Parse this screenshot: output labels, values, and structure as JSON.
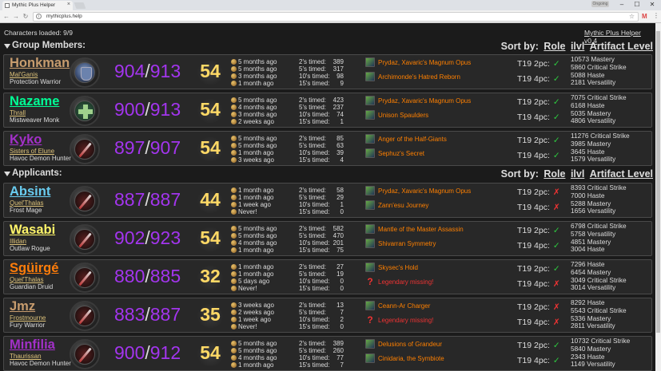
{
  "browser": {
    "tab_title": "Mythic Plus Helper",
    "tab_close": "×",
    "profile_label": "Ongoing",
    "url": "mythicplus.help",
    "win_min": "–",
    "win_max": "☐",
    "win_close": "✕"
  },
  "page": {
    "status": "Characters loaded: 9/9",
    "version": "Mythic Plus Helper v0.4"
  },
  "sections": {
    "group": {
      "title": "Group Members:"
    },
    "applicants": {
      "title": "Applicants:"
    },
    "sort_label": "Sort by:",
    "sort_options": [
      "Role",
      "ilvl",
      "Artifact Level"
    ]
  },
  "class_colors": {
    "warrior": "#c79c6e",
    "monk": "#00ff96",
    "demon_hunter": "#a330c9",
    "mage": "#69ccf0",
    "rogue": "#fff569",
    "druid": "#ff7d0a",
    "hunter": "#abd473"
  },
  "players": [
    {
      "name": "Honkman",
      "server": "Mal'Ganis",
      "spec": "Protection Warrior",
      "color": "#c79c6e",
      "icon": "shield-icon",
      "avatar": "av-shield",
      "ilvl": "904",
      "ilvl_max": "913",
      "mplus": "54",
      "times": [
        "5 months ago",
        "5 months ago",
        "3 months ago",
        "1 month ago"
      ],
      "keys": [
        [
          "2's timed:",
          "389"
        ],
        [
          "5's timed:",
          "317"
        ],
        [
          "10's timed:",
          "98"
        ],
        [
          "15's timed:",
          "9"
        ]
      ],
      "legendaries": [
        "Prydaz, Xavaric's Magnum Opus",
        "Archimonde's Hatred Reborn"
      ],
      "t19_2pc": "✓",
      "t19_4pc": "✓",
      "stats": [
        "10573 Mastery",
        "5860 Critical Strike",
        "5088 Haste",
        "2181 Versatility"
      ]
    },
    {
      "name": "Nazame",
      "server": "Thrall",
      "spec": "Mistweaver Monk",
      "color": "#00ff96",
      "icon": "cross-icon",
      "avatar": "av-cross",
      "ilvl": "900",
      "ilvl_max": "913",
      "mplus": "54",
      "times": [
        "5 months ago",
        "4 months ago",
        "3 months ago",
        "2 weeks ago"
      ],
      "keys": [
        [
          "2's timed:",
          "423"
        ],
        [
          "5's timed:",
          "237"
        ],
        [
          "10's timed:",
          "74"
        ],
        [
          "15's timed:",
          "1"
        ]
      ],
      "legendaries": [
        "Prydaz, Xavaric's Magnum Opus",
        "Unison Spaulders"
      ],
      "t19_2pc": "✓",
      "t19_4pc": "✓",
      "stats": [
        "7075 Critical Strike",
        "6168 Haste",
        "5035 Mastery",
        "4806 Versatility"
      ]
    },
    {
      "name": "Kyko",
      "server": "Sisters of Elune",
      "spec": "Havoc Demon Hunter",
      "color": "#a330c9",
      "icon": "dagger-icon",
      "avatar": "av-dagger",
      "ilvl": "897",
      "ilvl_max": "907",
      "mplus": "54",
      "times": [
        "5 months ago",
        "5 months ago",
        "1 month ago",
        "3 weeks ago"
      ],
      "keys": [
        [
          "2's timed:",
          "85"
        ],
        [
          "5's timed:",
          "63"
        ],
        [
          "10's timed:",
          "39"
        ],
        [
          "15's timed:",
          "4"
        ]
      ],
      "legendaries": [
        "Anger of the Half-Giants",
        "Sephuz's Secret"
      ],
      "t19_2pc": "✓",
      "t19_4pc": "✓",
      "stats": [
        "11276 Critical Strike",
        "3985 Mastery",
        "3645 Haste",
        "1579 Versatility"
      ]
    },
    {
      "name": "Absint",
      "server": "Quel'Thalas",
      "spec": "Frost Mage",
      "color": "#69ccf0",
      "icon": "dagger-icon",
      "avatar": "av-dagger",
      "ilvl": "887",
      "ilvl_max": "887",
      "mplus": "44",
      "times": [
        "1 month ago",
        "1 month ago",
        "1 week ago",
        "Never!"
      ],
      "keys": [
        [
          "2's timed:",
          "58"
        ],
        [
          "5's timed:",
          "29"
        ],
        [
          "10's timed:",
          "1"
        ],
        [
          "15's timed:",
          "0"
        ]
      ],
      "legendaries": [
        "Prydaz, Xavaric's Magnum Opus",
        "Zann'esu Journey"
      ],
      "t19_2pc": "✗",
      "t19_4pc": "✗",
      "stats": [
        "8393 Critical Strike",
        "7000 Haste",
        "5288 Mastery",
        "1656 Versatility"
      ]
    },
    {
      "name": "Wasabi",
      "server": "Illidan",
      "spec": "Outlaw Rogue",
      "color": "#fff569",
      "icon": "dagger-icon",
      "avatar": "av-dagger",
      "ilvl": "902",
      "ilvl_max": "923",
      "mplus": "54",
      "times": [
        "5 months ago",
        "5 months ago",
        "4 months ago",
        "1 month ago"
      ],
      "keys": [
        [
          "2's timed:",
          "582"
        ],
        [
          "5's timed:",
          "470"
        ],
        [
          "10's timed:",
          "201"
        ],
        [
          "15's timed:",
          "75"
        ]
      ],
      "legendaries": [
        "Mantle of the Master Assassin",
        "Shivarran Symmetry"
      ],
      "t19_2pc": "✓",
      "t19_4pc": "✓",
      "stats": [
        "6798 Critical Strike",
        "5758 Versatility",
        "4851 Mastery",
        "3004 Haste"
      ]
    },
    {
      "name": "Sgüirgé",
      "server": "Quel'Thalas",
      "spec": "Guardian Druid",
      "color": "#ff7d0a",
      "icon": "dagger-icon",
      "avatar": "av-dagger",
      "ilvl": "880",
      "ilvl_max": "885",
      "mplus": "32",
      "times": [
        "1 month ago",
        "1 month ago",
        "5 days ago",
        "Never!"
      ],
      "keys": [
        [
          "2's timed:",
          "27"
        ],
        [
          "5's timed:",
          "19"
        ],
        [
          "10's timed:",
          "0"
        ],
        [
          "15's timed:",
          "0"
        ]
      ],
      "legendaries": [
        "Skysec's Hold",
        "Legendary missing!"
      ],
      "t19_2pc": "✓",
      "t19_4pc": "✗",
      "stats": [
        "7296 Haste",
        "6454 Mastery",
        "3049 Critical Strike",
        "3014 Versatility"
      ]
    },
    {
      "name": "Jmz",
      "server": "Frostmourne",
      "spec": "Fury Warrior",
      "color": "#c79c6e",
      "icon": "dagger-icon",
      "avatar": "av-dagger",
      "ilvl": "883",
      "ilvl_max": "887",
      "mplus": "35",
      "times": [
        "3 weeks ago",
        "2 weeks ago",
        "1 week ago",
        "Never!"
      ],
      "keys": [
        [
          "2's timed:",
          "13"
        ],
        [
          "5's timed:",
          "7"
        ],
        [
          "10's timed:",
          "2"
        ],
        [
          "15's timed:",
          "0"
        ]
      ],
      "legendaries": [
        "Ceann-Ar Charger",
        "Legendary missing!"
      ],
      "t19_2pc": "✗",
      "t19_4pc": "✗",
      "stats": [
        "8292 Haste",
        "5543 Critical Strike",
        "5336 Mastery",
        "2811 Versatility"
      ]
    },
    {
      "name": "Minfilia",
      "server": "Thaurissan",
      "spec": "Havoc Demon Hunter",
      "color": "#a330c9",
      "icon": "dagger-icon",
      "avatar": "av-dagger",
      "ilvl": "900",
      "ilvl_max": "912",
      "mplus": "54",
      "times": [
        "5 months ago",
        "5 months ago",
        "4 months ago",
        "1 month ago"
      ],
      "keys": [
        [
          "2's timed:",
          "389"
        ],
        [
          "5's timed:",
          "260"
        ],
        [
          "10's timed:",
          "77"
        ],
        [
          "15's timed:",
          "7"
        ]
      ],
      "legendaries": [
        "Delusions of Grandeur",
        "Cinidaria, the Symbiote"
      ],
      "t19_2pc": "✓",
      "t19_4pc": "✓",
      "stats": [
        "10732 Critical Strike",
        "5840 Mastery",
        "2343 Haste",
        "1149 Versatility"
      ]
    }
  ],
  "tier_labels": {
    "two": "T19 2pc:",
    "four": "T19 4pc:"
  },
  "missing_marker": "?"
}
